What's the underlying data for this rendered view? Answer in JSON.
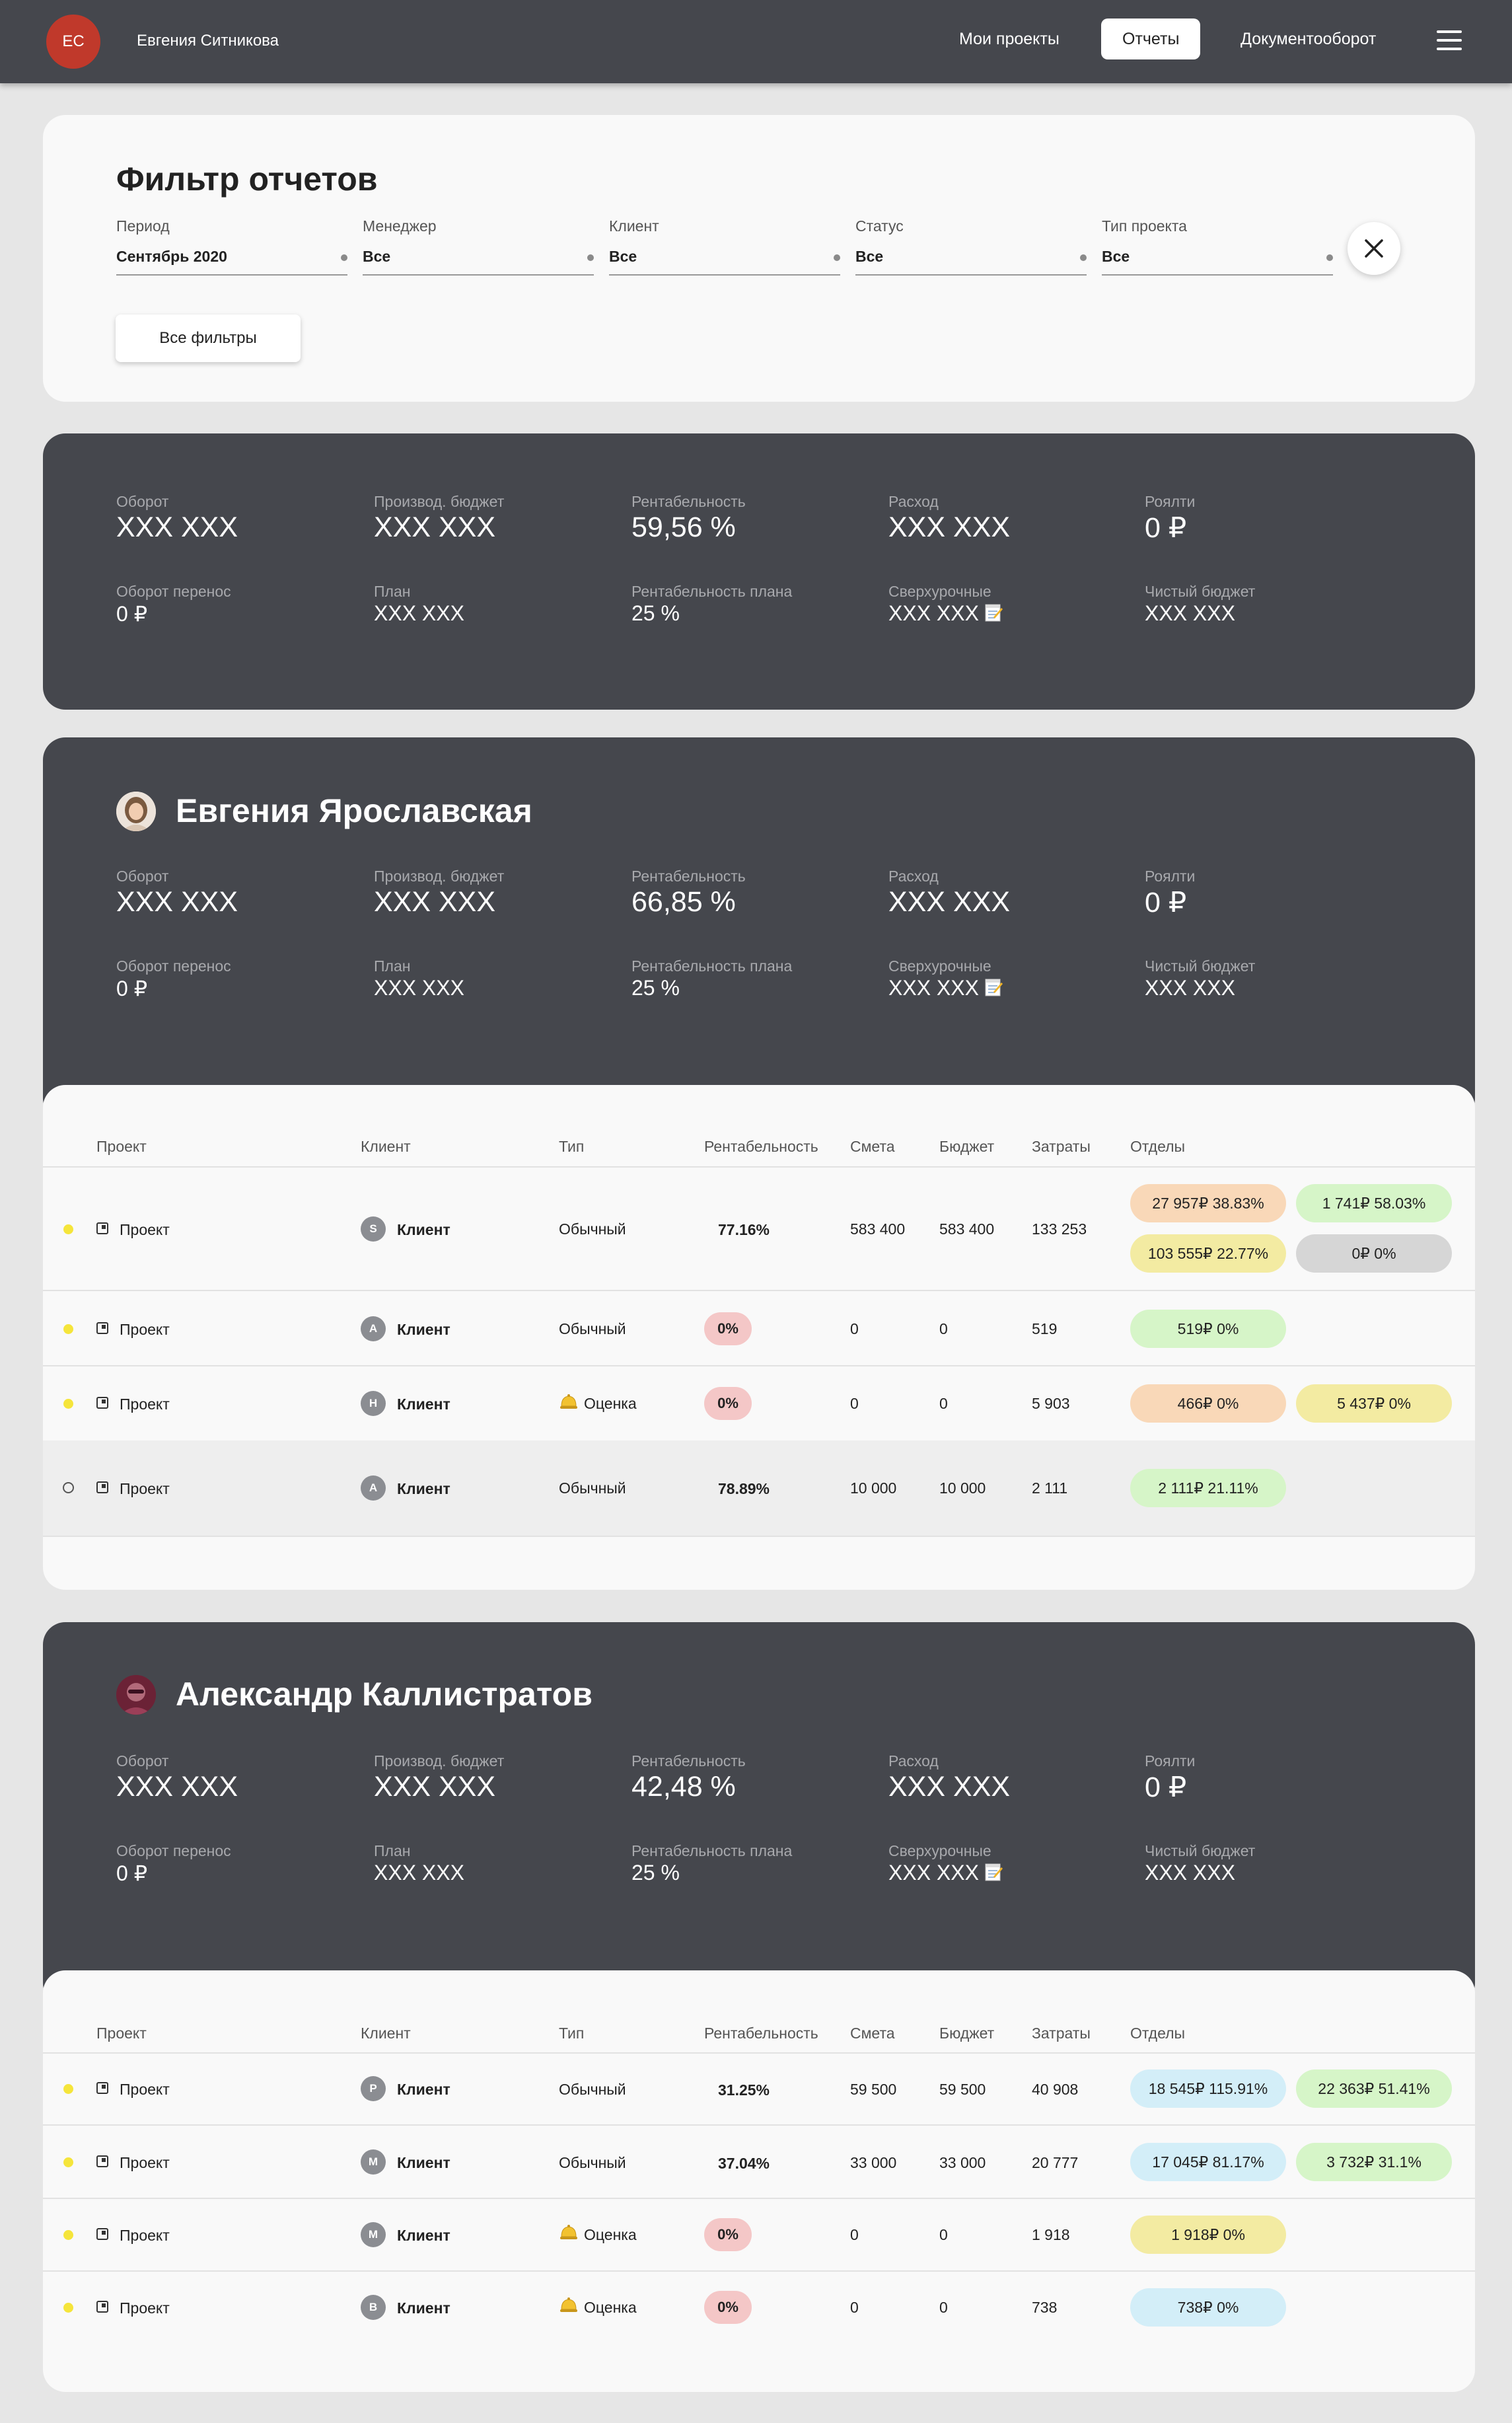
{
  "header": {
    "avatar_initials": "ЕС",
    "user_name": "Евгения Ситникова",
    "nav": [
      "Мои проекты",
      "Отчеты",
      "Документооборот"
    ],
    "active_nav": "Отчеты",
    "menu_icon": "hamburger-icon"
  },
  "filters": {
    "title": "Фильтр отчетов",
    "fields": [
      {
        "label": "Период",
        "value": "Сентябрь 2020"
      },
      {
        "label": "Менеджер",
        "value": "Все"
      },
      {
        "label": "Клиент",
        "value": "Все"
      },
      {
        "label": "Статус",
        "value": "Все"
      },
      {
        "label": "Тип проекта",
        "value": "Все"
      }
    ],
    "all_filters_label": "Все фильтры",
    "close_icon": "close-icon"
  },
  "stat_labels": {
    "turnover": "Оборот",
    "prod_budget": "Производ. бюджет",
    "profitability": "Рентабельность",
    "expense": "Расход",
    "royalty": "Роялти",
    "turnover_carry": "Оборот перенос",
    "plan": "План",
    "plan_profitability": "Рентабельность плана",
    "overtime": "Сверхурочные",
    "net_budget": "Чистый бюджет"
  },
  "summary": {
    "turnover": "XXX XXX",
    "prod_budget": "XXX XXX",
    "profitability": "59,56 %",
    "expense": "XXX XXX",
    "royalty": "0 ₽",
    "turnover_carry": "0 ₽",
    "plan": "XXX XXX",
    "plan_profitability": "25 %",
    "overtime": "XXX XXX",
    "net_budget": "XXX XXX"
  },
  "table_headers": [
    "Проект",
    "Клиент",
    "Тип",
    "Рентабельность",
    "Смета",
    "Бюджет",
    "Затраты",
    "Отделы"
  ],
  "managers": [
    {
      "name": "Евгения Ярославская",
      "stats": {
        "turnover": "XXX XXX",
        "prod_budget": "XXX XXX",
        "profitability": "66,85 %",
        "expense": "XXX XXX",
        "royalty": "0 ₽",
        "turnover_carry": "0 ₽",
        "plan": "XXX XXX",
        "plan_profitability": "25 %",
        "overtime": "XXX XXX",
        "net_budget": "XXX XXX"
      },
      "rows": [
        {
          "project": "Проект",
          "client_initial": "S",
          "client": "Клиент",
          "type": "Обычный",
          "profitability": "77.16%",
          "estimate": "583 400",
          "budget": "583 400",
          "costs": "133 253",
          "departments": [
            {
              "text": "27 957₽ 38.83%",
              "color": "#f9d8b8"
            },
            {
              "text": "1 741₽ 58.03%",
              "color": "#d6f5c8"
            },
            {
              "text": "103 555₽ 22.77%",
              "color": "#f3eba2"
            },
            {
              "text": "0₽ 0%",
              "color": "#d6d6d6"
            }
          ]
        },
        {
          "project": "Проект",
          "client_initial": "A",
          "client": "Клиент",
          "type": "Обычный",
          "profitability": "0%",
          "estimate": "0",
          "budget": "0",
          "costs": "519",
          "departments": [
            {
              "text": "519₽ 0%",
              "color": "#d6f5c8"
            }
          ]
        },
        {
          "project": "Проект",
          "client_initial": "H",
          "client": "Клиент",
          "type": "Оценка",
          "profitability": "0%",
          "estimate": "0",
          "budget": "0",
          "costs": "5 903",
          "departments": [
            {
              "text": "466₽ 0%",
              "color": "#f9d8b8"
            },
            {
              "text": "5 437₽ 0%",
              "color": "#f3eba2"
            }
          ]
        },
        {
          "project": "Проект",
          "client_initial": "A",
          "client": "Клиент",
          "type": "Обычный",
          "profitability": "78.89%",
          "estimate": "10 000",
          "budget": "10 000",
          "costs": "2 111",
          "departments": [
            {
              "text": "2 111₽ 21.11%",
              "color": "#d6f5c8"
            }
          ]
        }
      ]
    },
    {
      "name": "Александр Каллистратов",
      "stats": {
        "turnover": "XXX XXX",
        "prod_budget": "XXX XXX",
        "profitability": "42,48 %",
        "expense": "XXX XXX",
        "royalty": "0 ₽",
        "turnover_carry": "0 ₽",
        "plan": "XXX XXX",
        "plan_profitability": "25 %",
        "overtime": "XXX XXX",
        "net_budget": "XXX XXX"
      },
      "rows": [
        {
          "project": "Проект",
          "client_initial": "P",
          "client": "Клиент",
          "type": "Обычный",
          "profitability": "31.25%",
          "estimate": "59 500",
          "budget": "59 500",
          "costs": "40 908",
          "departments": [
            {
              "text": "18 545₽ 115.91%",
              "color": "#d3eef8"
            },
            {
              "text": "22 363₽ 51.41%",
              "color": "#d6f5c8"
            }
          ]
        },
        {
          "project": "Проект",
          "client_initial": "M",
          "client": "Клиент",
          "type": "Обычный",
          "profitability": "37.04%",
          "estimate": "33 000",
          "budget": "33 000",
          "costs": "20 777",
          "departments": [
            {
              "text": "17 045₽ 81.17%",
              "color": "#d3eef8"
            },
            {
              "text": "3 732₽ 31.1%",
              "color": "#d6f5c8"
            }
          ]
        },
        {
          "project": "Проект",
          "client_initial": "M",
          "client": "Клиент",
          "type": "Оценка",
          "profitability": "0%",
          "estimate": "0",
          "budget": "0",
          "costs": "1 918",
          "departments": [
            {
              "text": "1 918₽ 0%",
              "color": "#f3eba2"
            }
          ]
        },
        {
          "project": "Проект",
          "client_initial": "B",
          "client": "Клиент",
          "type": "Оценка",
          "profitability": "0%",
          "estimate": "0",
          "budget": "0",
          "costs": "738",
          "departments": [
            {
              "text": "738₽ 0%",
              "color": "#d3eef8"
            }
          ]
        }
      ]
    }
  ]
}
